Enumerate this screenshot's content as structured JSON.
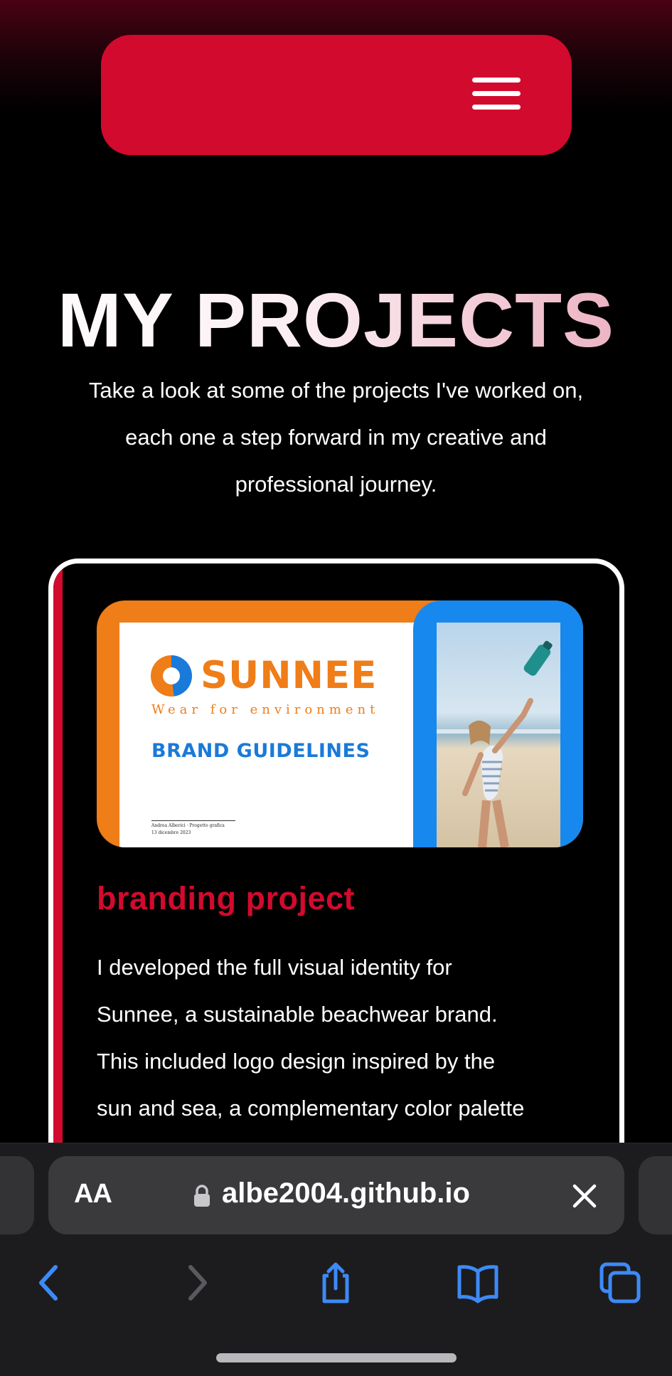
{
  "colors": {
    "accent": "#d20a2e",
    "background": "#000000",
    "brand_orange": "#ef7d18",
    "brand_blue": "#1a7ad9",
    "toolbar_blue": "#3d8af7"
  },
  "navbar": {
    "menu_icon": "hamburger-menu-icon"
  },
  "hero": {
    "title": "MY PROJECTS",
    "subtitle_lines": [
      "Take a look at some of the projects I've worked on,",
      "each one a step forward in my creative and",
      "professional journey."
    ]
  },
  "project": {
    "thumbnail": {
      "brand_name": "SUNNEE",
      "tagline": "Wear for environment",
      "doc_title": "BRAND GUIDELINES",
      "footer_line1": "Andrea Alberici · Progetto grafica",
      "footer_line2": "13 dicembre 2023"
    },
    "title": "branding project",
    "description_lines": [
      "I developed the full visual identity for",
      "Sunnee, a sustainable beachwear brand.",
      "This included logo design inspired by the",
      "sun and sea, a complementary color palette"
    ]
  },
  "browser": {
    "text_size_label": "AA",
    "url": "albe2004.github.io",
    "icons": {
      "lock": "lock-icon",
      "close": "close-icon",
      "back": "back-icon",
      "forward": "forward-icon",
      "share": "share-icon",
      "bookmarks": "bookmarks-icon",
      "tabs": "tabs-icon"
    }
  }
}
